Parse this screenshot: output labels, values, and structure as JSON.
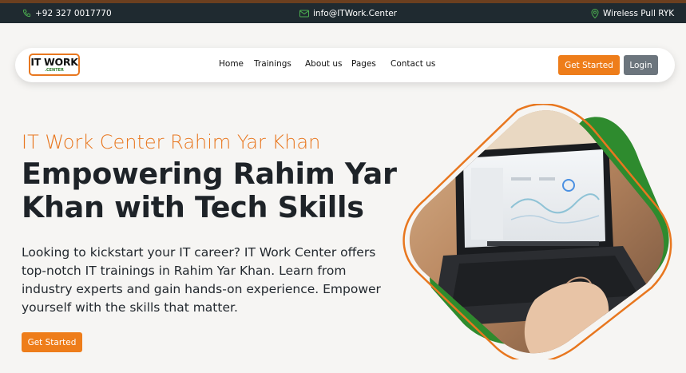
{
  "topbar": {
    "phone": "+92 327 0017770",
    "email": "info@ITWork.Center",
    "location": "Wireless Pull RYK",
    "icon_color": "#4caf50"
  },
  "nav": {
    "logo_text": "IT WORK",
    "logo_sub": ".CENTER",
    "items": [
      {
        "label": "Home"
      },
      {
        "label": "Trainings"
      },
      {
        "label": "About us"
      },
      {
        "label": "Pages"
      },
      {
        "label": "Contact us"
      }
    ],
    "get_started_label": "Get Started",
    "login_label": "Login"
  },
  "hero": {
    "subtitle": "IT Work Center Rahim Yar Khan",
    "headline": "Empowering Rahim Yar Khan with Tech Skills",
    "description": "Looking to kickstart your IT career? IT Work Center offers top-notch IT trainings in Rahim Yar Khan. Learn from industry experts and gain hands-on experience. Empower yourself with the skills that matter.",
    "cta_label": "Get Started",
    "image_icon": "laptop-photo"
  },
  "colors": {
    "accent": "#ee7d1a",
    "green": "#2e8b2e",
    "dark": "#1f2a30",
    "login": "#6c757d"
  }
}
